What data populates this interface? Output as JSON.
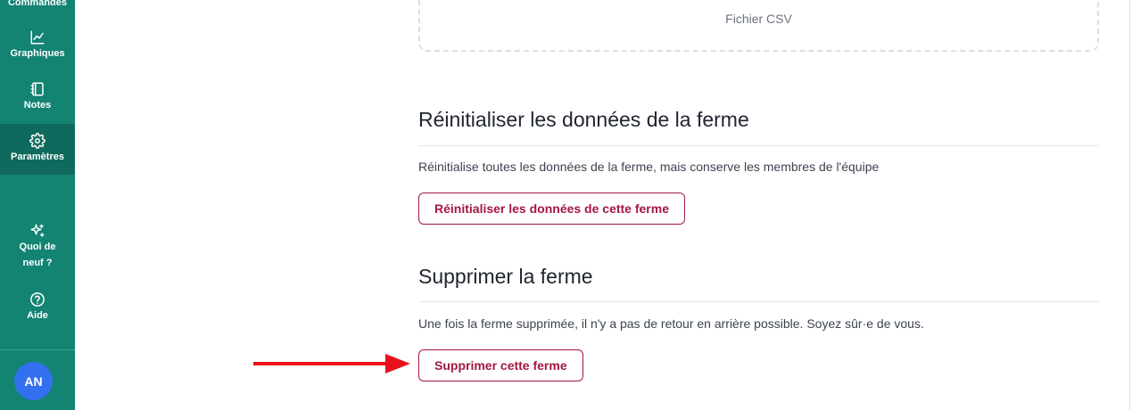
{
  "sidebar": {
    "items": [
      {
        "key": "commandes",
        "label": "Commandes",
        "icon": "list-icon"
      },
      {
        "key": "graphiques",
        "label": "Graphiques",
        "icon": "chart-line-icon"
      },
      {
        "key": "notes",
        "label": "Notes",
        "icon": "notebook-icon"
      },
      {
        "key": "parametres",
        "label": "Paramètres",
        "icon": "gear-icon",
        "active": true
      }
    ],
    "bottom": [
      {
        "key": "quoi_de_neuf",
        "label_line1": "Quoi de",
        "label_line2": "neuf ?",
        "icon": "sparkles-icon"
      },
      {
        "key": "aide",
        "label": "Aide",
        "icon": "help-circle-icon"
      }
    ],
    "avatar_initials": "AN",
    "colors": {
      "background": "#138372",
      "active": "#0f6a5d",
      "avatar": "#3370ef"
    }
  },
  "main": {
    "csv_box_label": "Fichier CSV",
    "reset": {
      "title": "Réinitialiser les données de la ferme",
      "description": "Réinitialise toutes les données de la ferme, mais conserve les membres de l'équipe",
      "button": "Réinitialiser les données de cette ferme"
    },
    "delete": {
      "title": "Supprimer la ferme",
      "description": "Une fois la ferme supprimée, il n'y a pas de retour en arrière possible. Soyez sûr·e de vous.",
      "button": "Supprimer cette ferme"
    },
    "colors": {
      "danger": "#a4173f",
      "annotation_arrow": "#e8101a"
    }
  }
}
